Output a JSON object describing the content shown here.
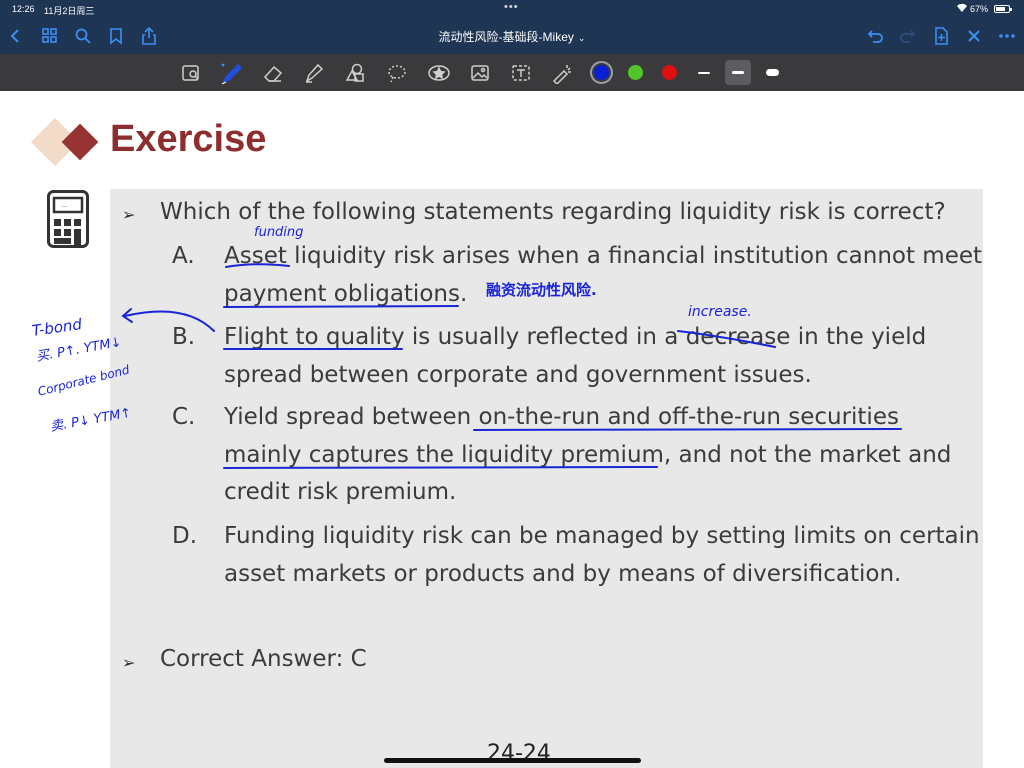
{
  "status_bar": {
    "time": "12:26",
    "date": "11月2日周三",
    "more_dots": "•••",
    "battery_percent": "67%",
    "battery_level": 0.67
  },
  "app_bar": {
    "document_title": "流动性风险-基础段-Mikey",
    "icons": [
      "back-icon",
      "grid-icon",
      "search-icon",
      "bookmark-icon",
      "share-icon",
      "undo-icon",
      "redo-icon",
      "add-page-icon",
      "close-icon",
      "more-icon"
    ]
  },
  "toolbar": {
    "tools": [
      "lasso-image-icon",
      "pen-icon",
      "eraser-icon",
      "highlighter-icon",
      "shapes-icon",
      "lasso-icon",
      "sticker-icon",
      "image-icon",
      "text-icon",
      "laser-icon"
    ],
    "colors": {
      "selected": "#0a1fd6",
      "green": "#51c62b",
      "red": "#de1010"
    }
  },
  "slide": {
    "title": "Exercise",
    "question": "Which of the following statements regarding liquidity risk is correct?",
    "options": [
      {
        "letter": "A.",
        "lines": [
          [
            {
              "t": "Asset",
              "u": false
            },
            {
              "t": " liquidity risk arises when a financial institution cannot meet",
              "u": false
            }
          ],
          [
            {
              "t": "payment obligations",
              "u": true
            },
            {
              "t": ".",
              "u": false
            }
          ]
        ]
      },
      {
        "letter": "B.",
        "lines": [
          [
            {
              "t": "Flight to quality",
              "u": true
            },
            {
              "t": " is usually reflected in a ",
              "u": false
            },
            {
              "t": "decrease",
              "u": false
            },
            {
              "t": " in the yield",
              "u": false
            }
          ],
          [
            {
              "t": "spread between corporate and government issues.",
              "u": false
            }
          ]
        ]
      },
      {
        "letter": "C.",
        "lines": [
          [
            {
              "t": "Yield spread between ",
              "u": false
            },
            {
              "t": "on-the-run and off-the-run securities",
              "u": true
            }
          ],
          [
            {
              "t": "mainly captures the liquidity premium",
              "u": true
            },
            {
              "t": ", and not the market and",
              "u": false
            }
          ],
          [
            {
              "t": "credit risk premium.",
              "u": false
            }
          ]
        ]
      },
      {
        "letter": "D.",
        "lines": [
          [
            {
              "t": "Funding liquidity risk can be managed by setting limits on certain",
              "u": false
            }
          ],
          [
            {
              "t": "asset markets or products and by means of diversification.",
              "u": false
            }
          ]
        ]
      }
    ],
    "answer": "Correct Answer: C",
    "page_number": "24-24"
  },
  "annotations": {
    "funding": "funding",
    "rongzi": "融资流动性风险.",
    "increase": "increase.",
    "tbond": "T-bond",
    "tbond_line": "买. P↑. YTM↓",
    "corporate": "Corporate bond",
    "corporate_line": "卖. P↓ YTM↑"
  }
}
